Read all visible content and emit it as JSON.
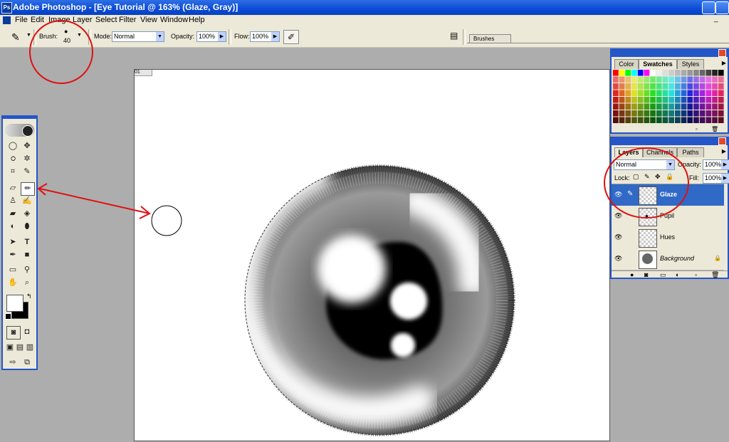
{
  "window": {
    "title": "Adobe Photoshop - [Eye Tutorial @ 163% (Glaze, Gray)]",
    "app_icon": "Ps"
  },
  "menu": [
    "File",
    "Edit",
    "Image",
    "Layer",
    "Select",
    "Filter",
    "View",
    "Window",
    "Help"
  ],
  "options": {
    "brush_label": "Brush:",
    "brush_size": "40",
    "mode_label": "Mode:",
    "mode_value": "Normal",
    "opacity_label": "Opacity:",
    "opacity_value": "100%",
    "flow_label": "Flow:",
    "flow_value": "100%",
    "brushes_tab": "Brushes"
  },
  "document": {
    "ruler_tag": "01"
  },
  "swatches_panel": {
    "tabs": [
      "Color",
      "Swatches",
      "Styles"
    ],
    "active_tab": "Swatches"
  },
  "layers_panel": {
    "tabs": [
      "Layers",
      "Channels",
      "Paths"
    ],
    "blend_mode": "Normal",
    "opacity_label": "Opacity:",
    "opacity_value": "100%",
    "lock_label": "Lock:",
    "fill_label": "Fill:",
    "fill_value": "100%",
    "layers": [
      {
        "name": "Glaze",
        "selected": true
      },
      {
        "name": "Pupil",
        "selected": false
      },
      {
        "name": "Hues",
        "selected": false
      },
      {
        "name": "Background",
        "selected": false,
        "locked": true
      }
    ]
  },
  "colors": {
    "accent": "#0a4bd6",
    "annotation": "#e01010",
    "panel": "#ece9d8"
  }
}
